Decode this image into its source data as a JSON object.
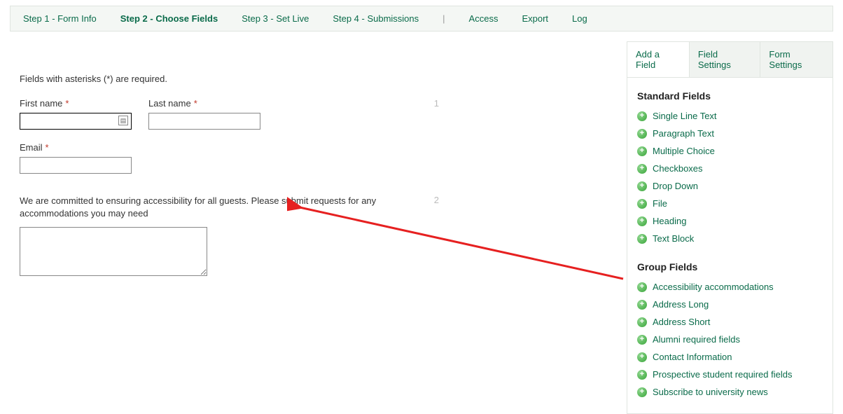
{
  "topnav": {
    "items": [
      {
        "label": "Step 1 - Form Info"
      },
      {
        "label": "Step 2 - Choose Fields"
      },
      {
        "label": "Step 3 - Set Live"
      },
      {
        "label": "Step 4 - Submissions"
      }
    ],
    "divider": "|",
    "extras": [
      {
        "label": "Access"
      },
      {
        "label": "Export"
      },
      {
        "label": "Log"
      }
    ]
  },
  "form": {
    "required_note": "Fields with asterisks (*) are required.",
    "row1_number": "1",
    "row2_number": "2",
    "first_name_label": "First name",
    "last_name_label": "Last name",
    "email_label": "Email",
    "asterisk": "*",
    "accessibility_text": "We are committed to ensuring accessibility for all guests. Please submit requests for any accommodations you may need"
  },
  "sidebar": {
    "tabs": [
      {
        "label": "Add a Field"
      },
      {
        "label": "Field Settings"
      },
      {
        "label": "Form Settings"
      }
    ],
    "standard_heading": "Standard Fields",
    "group_heading": "Group Fields",
    "standard_fields": [
      {
        "label": "Single Line Text"
      },
      {
        "label": "Paragraph Text"
      },
      {
        "label": "Multiple Choice"
      },
      {
        "label": "Checkboxes"
      },
      {
        "label": "Drop Down"
      },
      {
        "label": "File"
      },
      {
        "label": "Heading"
      },
      {
        "label": "Text Block"
      }
    ],
    "group_fields": [
      {
        "label": "Accessibility accommodations"
      },
      {
        "label": "Address Long"
      },
      {
        "label": "Address Short"
      },
      {
        "label": "Alumni required fields"
      },
      {
        "label": "Contact Information"
      },
      {
        "label": "Prospective student required fields"
      },
      {
        "label": "Subscribe to university news"
      }
    ]
  }
}
